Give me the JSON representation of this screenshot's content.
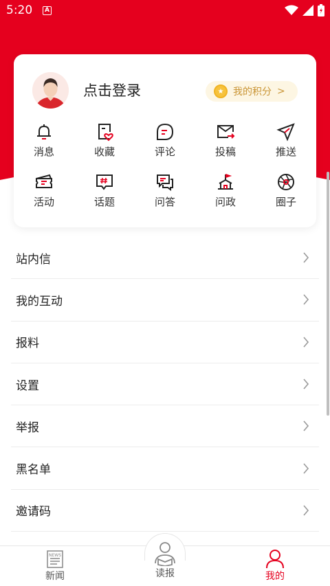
{
  "status_bar": {
    "time": "5:20",
    "notification": "A"
  },
  "profile": {
    "login_text": "点击登录",
    "points_label": "我的积分",
    "points_arrow": ">"
  },
  "grid": [
    {
      "label": "消息",
      "icon": "bell-icon"
    },
    {
      "label": "收藏",
      "icon": "bookmark-heart-icon"
    },
    {
      "label": "评论",
      "icon": "comment-icon"
    },
    {
      "label": "投稿",
      "icon": "mail-send-icon"
    },
    {
      "label": "推送",
      "icon": "paper-plane-icon"
    },
    {
      "label": "活动",
      "icon": "ticket-icon"
    },
    {
      "label": "话题",
      "icon": "hashtag-chat-icon"
    },
    {
      "label": "问答",
      "icon": "qa-chat-icon"
    },
    {
      "label": "问政",
      "icon": "government-building-icon"
    },
    {
      "label": "圈子",
      "icon": "aperture-icon"
    }
  ],
  "menu": [
    {
      "label": "站内信"
    },
    {
      "label": "我的互动"
    },
    {
      "label": "报料"
    },
    {
      "label": "设置"
    },
    {
      "label": "举报"
    },
    {
      "label": "黑名单"
    },
    {
      "label": "邀请码"
    }
  ],
  "tabs": [
    {
      "label": "新闻",
      "icon": "newspaper-icon"
    },
    {
      "label": "读报",
      "icon": "reader-icon"
    },
    {
      "label": "我的",
      "icon": "user-icon",
      "active": true
    }
  ],
  "colors": {
    "brand_red": "#e5001e",
    "points_gold": "#c99434"
  }
}
